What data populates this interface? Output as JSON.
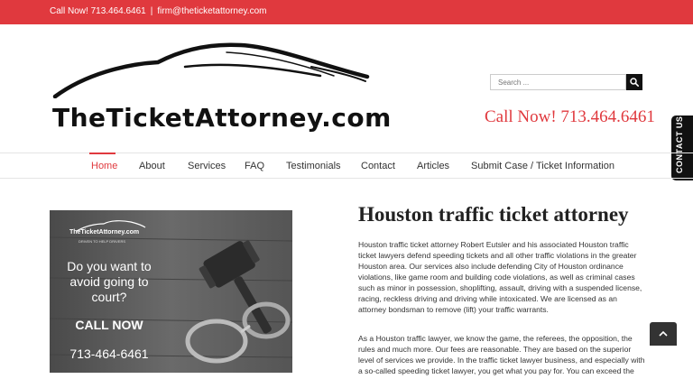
{
  "topbar": {
    "phone": "Call Now! 713.464.6461",
    "separator": "|",
    "email": "firm@theticketattorney.com"
  },
  "logo": {
    "text": "TheTicketAttorney.com"
  },
  "search": {
    "placeholder": "Search ..."
  },
  "header": {
    "call_now": "Call Now! 713.464.6461"
  },
  "nav": {
    "items": [
      {
        "label": "Home"
      },
      {
        "label": "About"
      },
      {
        "label": "Services"
      },
      {
        "label": "FAQ"
      },
      {
        "label": "Testimonials"
      },
      {
        "label": "Contact"
      },
      {
        "label": "Articles"
      },
      {
        "label": "Submit Case / Ticket Information"
      }
    ],
    "active": "Home"
  },
  "side_tab": {
    "label": "CONTACT US"
  },
  "promo": {
    "logo_text": "TheTicketAttorney.com",
    "tagline": "DRIVEN TO HELP DRIVERS",
    "question": "Do you want to avoid going to court?",
    "cta": "CALL NOW",
    "phone": "713-464-6461"
  },
  "main": {
    "title": "Houston traffic ticket attorney",
    "paragraphs": [
      "Houston traffic ticket attorney Robert Eutsler and his associated Houston traffic ticket lawyers defend speeding tickets and all other traffic violations in the greater Houston area. Our services also include defending City of Houston ordinance violations, like game room and building code violations, as well as criminal cases such as minor in possession, shoplifting, assault, driving with a suspended license, racing, reckless driving and driving while intoxicated. We are licensed as an attorney bondsman to remove (lift) your traffic warrants.",
      "As a Houston traffic lawyer, we know the game, the referees, the opposition, the rules and much more. Our fees are reasonable. They are based on the superior level of services we provide. In the traffic ticket lawyer business, and especially with a so-called speeding ticket lawyer, you get what you pay for. You can exceed the speed limit in Texas and still not"
    ]
  },
  "colors": {
    "accent": "#e0393e",
    "dark": "#111111"
  },
  "icons": {
    "search": "search-icon",
    "to_top": "chevron-up-icon"
  }
}
